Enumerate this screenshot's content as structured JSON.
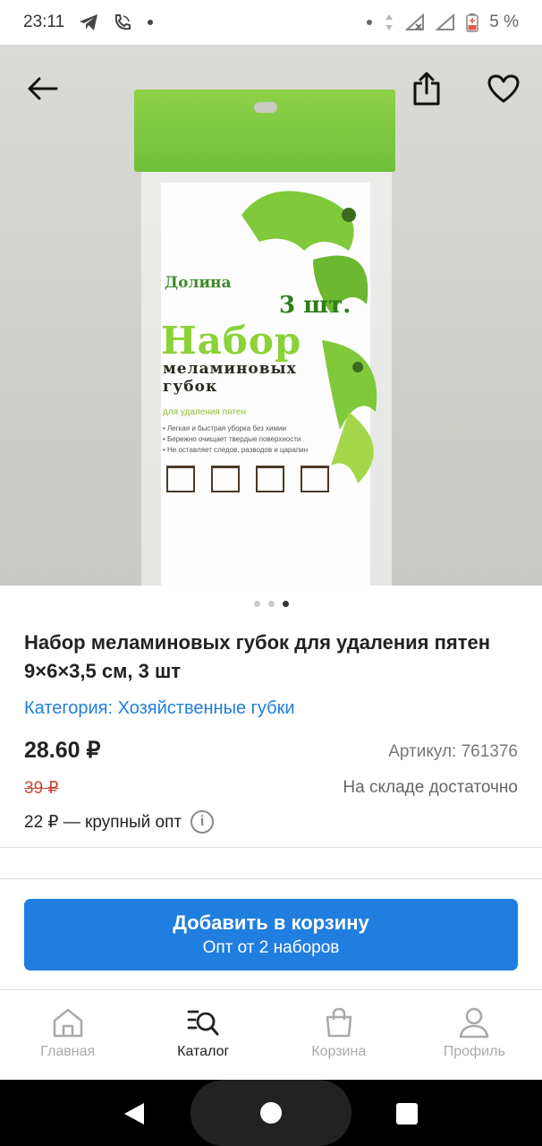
{
  "status": {
    "time": "23:11",
    "battery": "5 %"
  },
  "hero": {
    "dots": 3,
    "active_dot": 3,
    "package": {
      "brand": "Долина",
      "count": "3 шт.",
      "line1": "Набор",
      "line2": "меламиновых",
      "line3": "губок",
      "sub": "для удаления пятен",
      "bullets": [
        "• Легкая и быстрая уборка без химии",
        "• Бережно очищает твердые поверхности",
        "• Не оставляет следов, разводов и царапин"
      ]
    }
  },
  "product": {
    "title": "Набор меламиновых губок для удаления пятен 9×6×3,5 см, 3 шт",
    "category": "Категория: Хозяйственные губки",
    "price": "28.60 ₽",
    "article": "Артикул: 761376",
    "old_price": "39 ₽",
    "stock": "На складе достаточно",
    "wholesale": "22 ₽ — крупный опт"
  },
  "cart_button": {
    "label": "Добавить в корзину",
    "sublabel": "Опт от 2 наборов"
  },
  "nav": {
    "items": [
      {
        "label": "Главная",
        "icon": "home-icon"
      },
      {
        "label": "Каталог",
        "icon": "catalog-search-icon"
      },
      {
        "label": "Корзина",
        "icon": "cart-bag-icon"
      },
      {
        "label": "Профиль",
        "icon": "profile-icon"
      }
    ],
    "active": "Каталог"
  },
  "colors": {
    "accent": "#1f7ee0",
    "link": "#1f7fd8",
    "old_price": "#c64a3c",
    "nav_inactive": "#aaaaaa"
  }
}
